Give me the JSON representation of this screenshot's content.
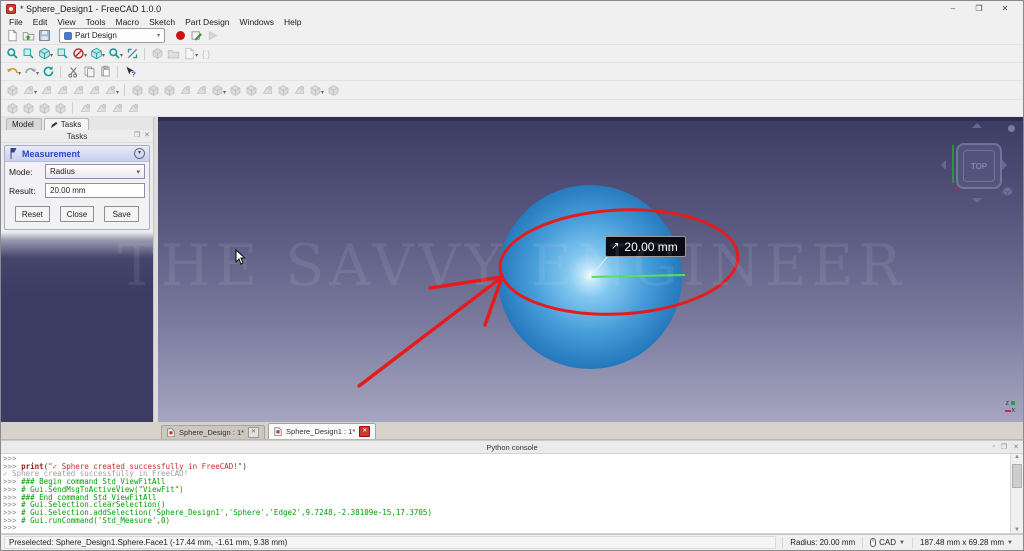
{
  "window": {
    "title": "* Sphere_Design1 - FreeCAD 1.0.0",
    "minimize": "–",
    "maximize": "❐",
    "close": "✕"
  },
  "menu": {
    "items": [
      "File",
      "Edit",
      "View",
      "Tools",
      "Macro",
      "Sketch",
      "Part Design",
      "Windows",
      "Help"
    ]
  },
  "toolbars": {
    "workbench_label": "Part Design",
    "file_row": [
      {
        "name": "new-file-icon",
        "icon": "page"
      },
      {
        "name": "open-file-icon",
        "icon": "folder"
      },
      {
        "name": "save-file-icon",
        "icon": "floppy"
      },
      {
        "wb": true
      },
      {
        "name": "macro-record-icon",
        "icon": "record"
      },
      {
        "name": "macro-edit-icon",
        "icon": "macroedit"
      },
      {
        "name": "macro-play-icon",
        "icon": "play",
        "disabled": true
      }
    ],
    "view_row": [
      {
        "name": "fit-all-icon",
        "icon": "magnifier"
      },
      {
        "name": "fit-selection-icon",
        "icon": "fitsel"
      },
      {
        "name": "axonometric-view-icon",
        "icon": "cubeTeal",
        "dd": true
      },
      {
        "name": "sync-view-icon",
        "icon": "fitsel"
      },
      {
        "name": "draw-style-icon",
        "icon": "drawstyle",
        "dd": true
      },
      {
        "name": "view-cube-icon",
        "icon": "cubeTeal",
        "dd": true
      },
      {
        "name": "zoom-tools-icon",
        "icon": "magnifier",
        "dd": true
      },
      {
        "name": "measure-icon",
        "icon": "caliper"
      },
      {
        "sep": true
      },
      {
        "name": "appearance-icon",
        "icon": "graycube",
        "disabled": true
      },
      {
        "name": "group-icon",
        "icon": "folderGray",
        "disabled": true
      },
      {
        "name": "export-icon",
        "icon": "page",
        "disabled": true,
        "dd": true
      },
      {
        "name": "expression-brackets-icon",
        "icon": "brackets",
        "disabled": true
      }
    ],
    "edit_row": [
      {
        "name": "undo-icon",
        "icon": "undo",
        "dd": true
      },
      {
        "name": "redo-icon",
        "icon": "redo",
        "dd": true
      },
      {
        "name": "refresh-icon",
        "icon": "refresh"
      },
      {
        "sep": true
      },
      {
        "name": "cut-icon",
        "icon": "scissors"
      },
      {
        "name": "copy-icon",
        "icon": "copy"
      },
      {
        "name": "paste-icon",
        "icon": "paste"
      },
      {
        "sep": true
      },
      {
        "name": "whats-this-icon",
        "icon": "whatsthis"
      }
    ],
    "partdesign_row": [
      {
        "name": "create-body-icon",
        "icon": "graycube",
        "disabled": true
      },
      {
        "name": "create-sketch-icon",
        "icon": "grayshape",
        "disabled": true,
        "dd": true
      },
      {
        "name": "edit-sketch-icon",
        "icon": "grayshape",
        "disabled": true
      },
      {
        "name": "map-sketch-icon",
        "icon": "grayshape",
        "disabled": true
      },
      {
        "name": "create-datum-icon",
        "icon": "grayshape",
        "disabled": true
      },
      {
        "name": "shape-binder-icon",
        "icon": "grayshape",
        "disabled": true
      },
      {
        "name": "clone-icon",
        "icon": "grayshape",
        "disabled": true,
        "dd": true
      },
      {
        "sep": true
      },
      {
        "name": "pad-icon",
        "icon": "graycube",
        "disabled": true
      },
      {
        "name": "revolve-icon",
        "icon": "graycube",
        "disabled": true
      },
      {
        "name": "additive-loft-icon",
        "icon": "graycube",
        "disabled": true
      },
      {
        "name": "additive-pipe-icon",
        "icon": "grayshape",
        "disabled": true
      },
      {
        "name": "additive-helix-icon",
        "icon": "grayshape",
        "disabled": true
      },
      {
        "name": "additive-primitive-icon",
        "icon": "graycube",
        "disabled": true,
        "dd": true
      },
      {
        "name": "pocket-icon",
        "icon": "graycube",
        "disabled": true
      },
      {
        "name": "hole-icon",
        "icon": "graycube",
        "disabled": true
      },
      {
        "name": "groove-icon",
        "icon": "grayshape",
        "disabled": true
      },
      {
        "name": "subtractive-loft-icon",
        "icon": "graycube",
        "disabled": true
      },
      {
        "name": "subtractive-pipe-icon",
        "icon": "grayshape",
        "disabled": true
      },
      {
        "name": "subtractive-primitive-icon",
        "icon": "graycube",
        "disabled": true,
        "dd": true
      },
      {
        "name": "boolean-icon",
        "icon": "graycube",
        "disabled": true
      }
    ],
    "dressup_row": [
      {
        "name": "fillet-icon",
        "icon": "graycube",
        "disabled": true
      },
      {
        "name": "chamfer-icon",
        "icon": "graycube",
        "disabled": true
      },
      {
        "name": "draft-icon",
        "icon": "graycube",
        "disabled": true
      },
      {
        "name": "thickness-icon",
        "icon": "graycube",
        "disabled": true
      },
      {
        "sep": true
      },
      {
        "name": "mirrored-icon",
        "icon": "grayshape",
        "disabled": true
      },
      {
        "name": "linear-pattern-icon",
        "icon": "grayshape",
        "disabled": true
      },
      {
        "name": "polar-pattern-icon",
        "icon": "grayshape",
        "disabled": true
      },
      {
        "name": "multitransform-icon",
        "icon": "grayshape",
        "disabled": true
      }
    ]
  },
  "left_panel": {
    "tabs": [
      {
        "label": "Model"
      },
      {
        "label": "Tasks"
      }
    ],
    "dock_title": "Tasks",
    "measurement": {
      "title": "Measurement",
      "mode_label": "Mode:",
      "mode_value": "Radius",
      "result_label": "Result:",
      "result_value": "20.00 mm",
      "buttons": [
        "Reset",
        "Close",
        "Save"
      ]
    }
  },
  "viewport": {
    "measure_value": "20.00 mm",
    "nav_cube_label": "TOP",
    "watermark": "THE SAVVY ENGINEER",
    "axis_z": "z",
    "axis_x": "x"
  },
  "doc_tabs": [
    {
      "label": "Sphere_Design : 1*",
      "active": false
    },
    {
      "label": "Sphere_Design1 : 1*",
      "active": true
    }
  ],
  "console": {
    "title": "Python console",
    "lines": [
      {
        "segments": [
          {
            "t": ">>> ",
            "c": "p"
          }
        ]
      },
      {
        "segments": [
          {
            "t": ">>> ",
            "c": "p"
          },
          {
            "t": "print",
            "c": "kw"
          },
          {
            "t": "(",
            "c": "pl"
          },
          {
            "t": "\"✓ Sphere created successfully in FreeCAD!\"",
            "c": "str"
          },
          {
            "t": ")",
            "c": "pl"
          }
        ]
      },
      {
        "segments": [
          {
            "t": "✓ Sphere created successfully in FreeCAD!",
            "c": "out"
          }
        ]
      },
      {
        "segments": [
          {
            "t": ">>> ",
            "c": "p"
          },
          {
            "t": "### Begin command Std_ViewFitAll",
            "c": "cmt"
          }
        ]
      },
      {
        "segments": [
          {
            "t": ">>> ",
            "c": "p"
          },
          {
            "t": "# Gui.SendMsgToActiveView(\"ViewFit\")",
            "c": "cmt"
          }
        ]
      },
      {
        "segments": [
          {
            "t": ">>> ",
            "c": "p"
          },
          {
            "t": "### End command Std_ViewFitAll",
            "c": "cmt"
          }
        ]
      },
      {
        "segments": [
          {
            "t": ">>> ",
            "c": "p"
          },
          {
            "t": "# Gui.Selection.clearSelection()",
            "c": "cmt"
          }
        ]
      },
      {
        "segments": [
          {
            "t": ">>> ",
            "c": "p"
          },
          {
            "t": "# Gui.Selection.addSelection('Sphere_Design1','Sphere','Edge2',9.7248,-2.38109e-15,17.3705)",
            "c": "cmt"
          }
        ]
      },
      {
        "segments": [
          {
            "t": ">>> ",
            "c": "p"
          },
          {
            "t": "# Gui.runCommand('Std_Measure',0)",
            "c": "cmt"
          }
        ]
      },
      {
        "segments": [
          {
            "t": ">>>",
            "c": "p"
          }
        ]
      }
    ]
  },
  "status_bar": {
    "preselected": "Preselected: Sphere_Design1.Sphere.Face1 (-17.44 mm, -1.61 mm, 9.38 mm)",
    "radius": "Radius: 20.00 mm",
    "nav_style": "CAD",
    "dimensions": "187.48 mm x 69.28 mm"
  },
  "colors": {
    "accent_teal": "#169c9c",
    "record_red": "#cc1111",
    "annotation_red": "#e41c1c",
    "measure_green": "#55e055",
    "sphere_blue": "#2579bd",
    "console_comment_green": "#00a000",
    "panel_navy": "#3b3b63"
  }
}
